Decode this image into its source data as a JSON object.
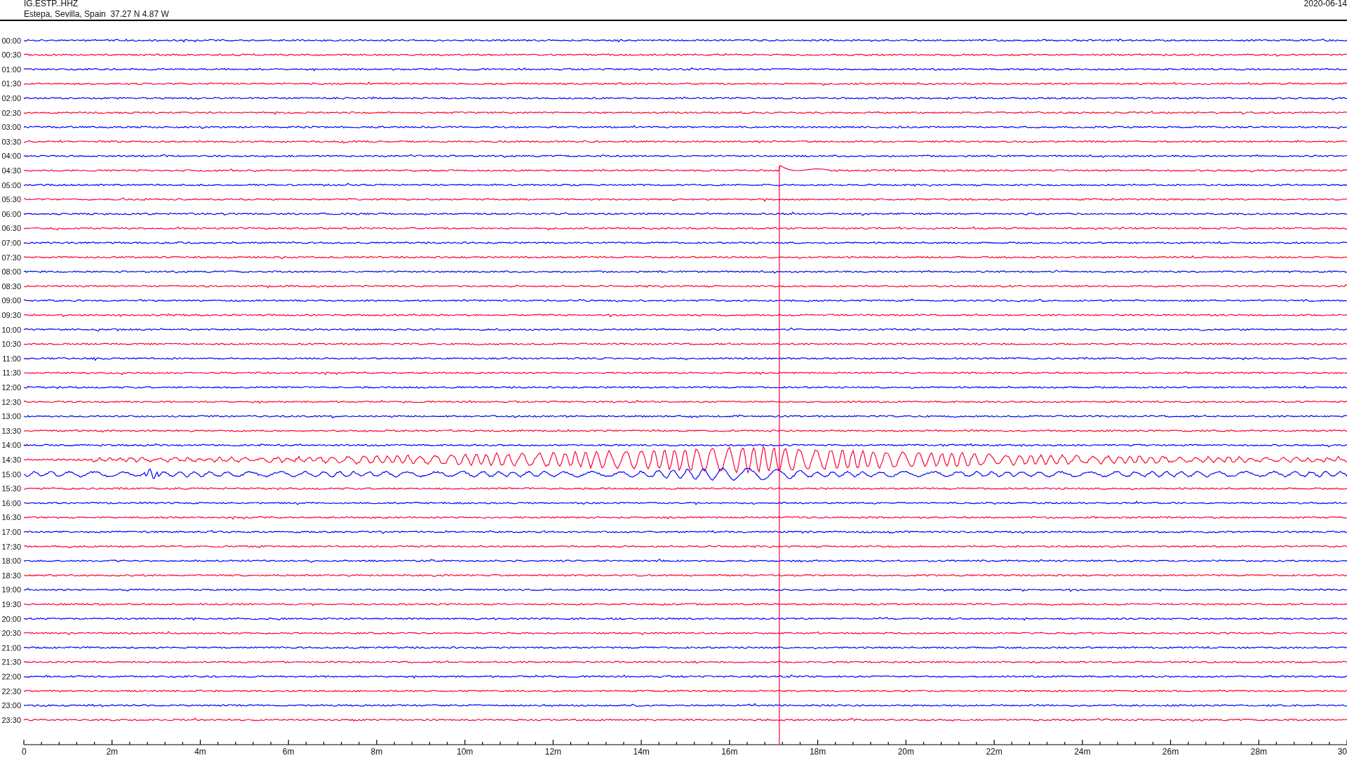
{
  "header": {
    "channel": "IG.ESTP..HHZ",
    "location": "Estepa, Sevilla, Spain  37.27 N 4.87 W",
    "date": "2020-06-14"
  },
  "rows": [
    {
      "time": "00:00",
      "color": "#0000ff",
      "kind": "noise"
    },
    {
      "time": "00:30",
      "color": "#ff0033",
      "kind": "noise"
    },
    {
      "time": "01:00",
      "color": "#0000ff",
      "kind": "noise"
    },
    {
      "time": "01:30",
      "color": "#ff0033",
      "kind": "noise"
    },
    {
      "time": "02:00",
      "color": "#0000ff",
      "kind": "noise"
    },
    {
      "time": "02:30",
      "color": "#ff0033",
      "kind": "noise"
    },
    {
      "time": "03:00",
      "color": "#0000ff",
      "kind": "noise"
    },
    {
      "time": "03:30",
      "color": "#ff0033",
      "kind": "noise"
    },
    {
      "time": "04:00",
      "color": "#0000ff",
      "kind": "noise"
    },
    {
      "time": "04:30",
      "color": "#ff0033",
      "kind": "pulse"
    },
    {
      "time": "05:00",
      "color": "#0000ff",
      "kind": "noise"
    },
    {
      "time": "05:30",
      "color": "#ff0033",
      "kind": "noise"
    },
    {
      "time": "06:00",
      "color": "#0000ff",
      "kind": "noise"
    },
    {
      "time": "06:30",
      "color": "#ff0033",
      "kind": "noise"
    },
    {
      "time": "07:00",
      "color": "#0000ff",
      "kind": "noise"
    },
    {
      "time": "07:30",
      "color": "#ff0033",
      "kind": "noise"
    },
    {
      "time": "08:00",
      "color": "#0000ff",
      "kind": "noise"
    },
    {
      "time": "08:30",
      "color": "#ff0033",
      "kind": "noise"
    },
    {
      "time": "09:00",
      "color": "#0000ff",
      "kind": "noise"
    },
    {
      "time": "09:30",
      "color": "#ff0033",
      "kind": "noise"
    },
    {
      "time": "10:00",
      "color": "#0000ff",
      "kind": "noise"
    },
    {
      "time": "10:30",
      "color": "#ff0033",
      "kind": "noise"
    },
    {
      "time": "11:00",
      "color": "#0000ff",
      "kind": "noise"
    },
    {
      "time": "11:30",
      "color": "#ff0033",
      "kind": "noise"
    },
    {
      "time": "12:00",
      "color": "#0000ff",
      "kind": "noise"
    },
    {
      "time": "12:30",
      "color": "#ff0033",
      "kind": "noise"
    },
    {
      "time": "13:00",
      "color": "#0000ff",
      "kind": "noise"
    },
    {
      "time": "13:30",
      "color": "#ff0033",
      "kind": "noise"
    },
    {
      "time": "14:00",
      "color": "#0000ff",
      "kind": "noise"
    },
    {
      "time": "14:30",
      "color": "#ff0033",
      "kind": "quake"
    },
    {
      "time": "15:00",
      "color": "#0000ff",
      "kind": "swell"
    },
    {
      "time": "15:30",
      "color": "#ff0033",
      "kind": "noise"
    },
    {
      "time": "16:00",
      "color": "#0000ff",
      "kind": "noise"
    },
    {
      "time": "16:30",
      "color": "#ff0033",
      "kind": "noise"
    },
    {
      "time": "17:00",
      "color": "#0000ff",
      "kind": "noise"
    },
    {
      "time": "17:30",
      "color": "#ff0033",
      "kind": "noise"
    },
    {
      "time": "18:00",
      "color": "#0000ff",
      "kind": "noise"
    },
    {
      "time": "18:30",
      "color": "#ff0033",
      "kind": "noise"
    },
    {
      "time": "19:00",
      "color": "#0000ff",
      "kind": "noise"
    },
    {
      "time": "19:30",
      "color": "#ff0033",
      "kind": "noise"
    },
    {
      "time": "20:00",
      "color": "#0000ff",
      "kind": "noise"
    },
    {
      "time": "20:30",
      "color": "#ff0033",
      "kind": "noise"
    },
    {
      "time": "21:00",
      "color": "#0000ff",
      "kind": "noise"
    },
    {
      "time": "21:30",
      "color": "#ff0033",
      "kind": "noise"
    },
    {
      "time": "22:00",
      "color": "#0000ff",
      "kind": "noise"
    },
    {
      "time": "22:30",
      "color": "#ff0033",
      "kind": "noise"
    },
    {
      "time": "23:00",
      "color": "#0000ff",
      "kind": "noise"
    },
    {
      "time": "23:30",
      "color": "#ff0033",
      "kind": "noise"
    }
  ],
  "x_axis": {
    "labels": [
      "0",
      "2m",
      "4m",
      "6m",
      "8m",
      "10m",
      "12m",
      "14m",
      "16m",
      "18m",
      "20m",
      "22m",
      "24m",
      "26m",
      "28m",
      "30"
    ]
  }
}
